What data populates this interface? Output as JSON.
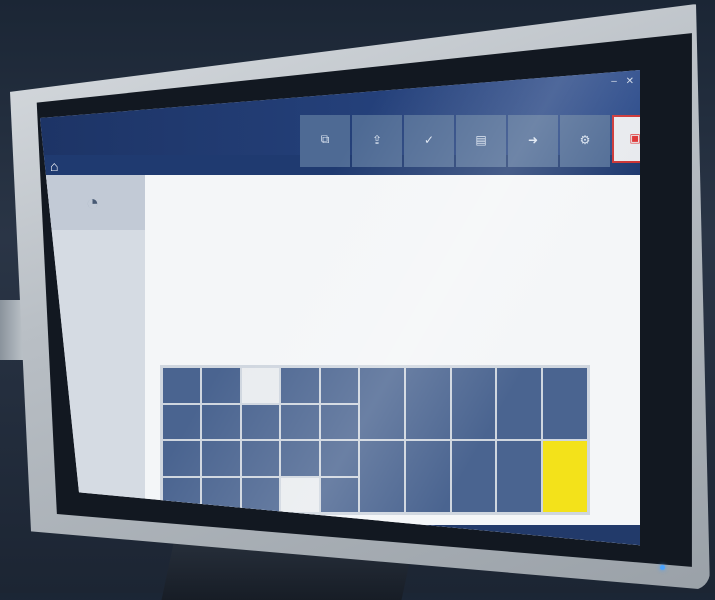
{
  "window": {
    "controls": [
      "–",
      "✕"
    ]
  },
  "toolbar": [
    {
      "icon": "copy-icon",
      "glyph": "⧉",
      "label": ""
    },
    {
      "icon": "upload-icon",
      "glyph": "⇪",
      "label": ""
    },
    {
      "icon": "check-icon",
      "glyph": "✓",
      "label": ""
    },
    {
      "icon": "document-icon",
      "glyph": "▤",
      "label": ""
    },
    {
      "icon": "arrow-icon",
      "glyph": "➜",
      "label": ""
    },
    {
      "icon": "gear-icon",
      "glyph": "⚙",
      "label": ""
    },
    {
      "icon": "exit-icon",
      "glyph": "▣",
      "label": ""
    }
  ],
  "main": {
    "section_title": ""
  },
  "magazine": {
    "small_rows": 4,
    "small_cols": 5,
    "large_rows": 2,
    "large_cols": 5,
    "empty_small": [
      2,
      18
    ],
    "selected_large": 9,
    "accent_color": "#f3e21a",
    "cell_color": "#4a6490"
  },
  "taskbar": {
    "clock": ""
  }
}
